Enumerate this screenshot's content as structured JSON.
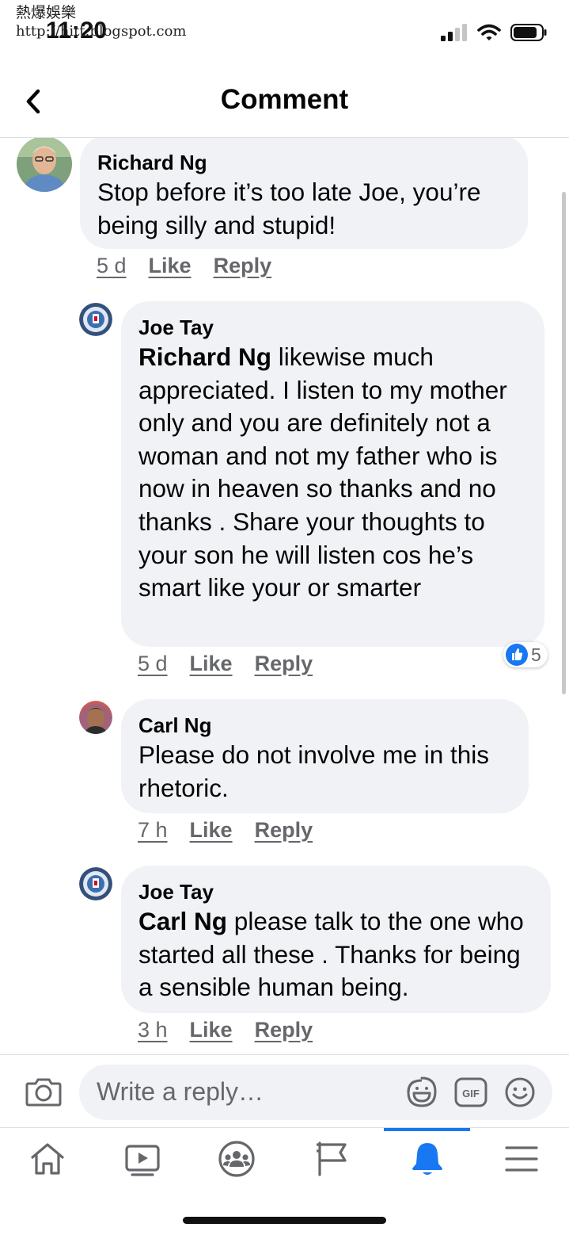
{
  "watermark": {
    "title": "熱爆娛樂",
    "url": "http://hitt.blogspot.com"
  },
  "status": {
    "time": "11:20"
  },
  "header": {
    "title": "Comment"
  },
  "comments": [
    {
      "author": "Richard Ng",
      "mention": "",
      "text": "Stop before it’s too late Joe, you’re being silly and stupid!",
      "time": "5 d",
      "like": "Like",
      "reply": "Reply"
    },
    {
      "author": "Joe Tay",
      "mention": "Richard Ng",
      "text": "likewise much appreciated. I listen to my mother only and you are definitely not a woman and not my father who is now in heaven so thanks and no thanks . Share your thoughts to your son he will listen cos he’s smart like your or smarter",
      "time": "5 d",
      "like": "Like",
      "reply": "Reply",
      "reaction_count": "5"
    },
    {
      "author": "Carl Ng",
      "mention": "",
      "text": "Please do not involve me in this rhetoric.",
      "time": "7 h",
      "like": "Like",
      "reply": "Reply"
    },
    {
      "author": "Joe Tay",
      "mention": "Carl Ng",
      "text": "please talk to the one who started all these . Thanks for being a sensible human being.",
      "time": "3 h",
      "like": "Like",
      "reply": "Reply"
    }
  ],
  "composer": {
    "placeholder": "Write a reply…",
    "gif_label": "GIF"
  },
  "nav": {
    "items": [
      "home-icon",
      "video-icon",
      "groups-icon",
      "pages-flag-icon",
      "notifications-bell-icon",
      "menu-icon"
    ],
    "active_color": "#1877f2"
  },
  "colors": {
    "bubble": "#f0f2f5",
    "meta": "#65676b",
    "accent": "#1877f2"
  }
}
